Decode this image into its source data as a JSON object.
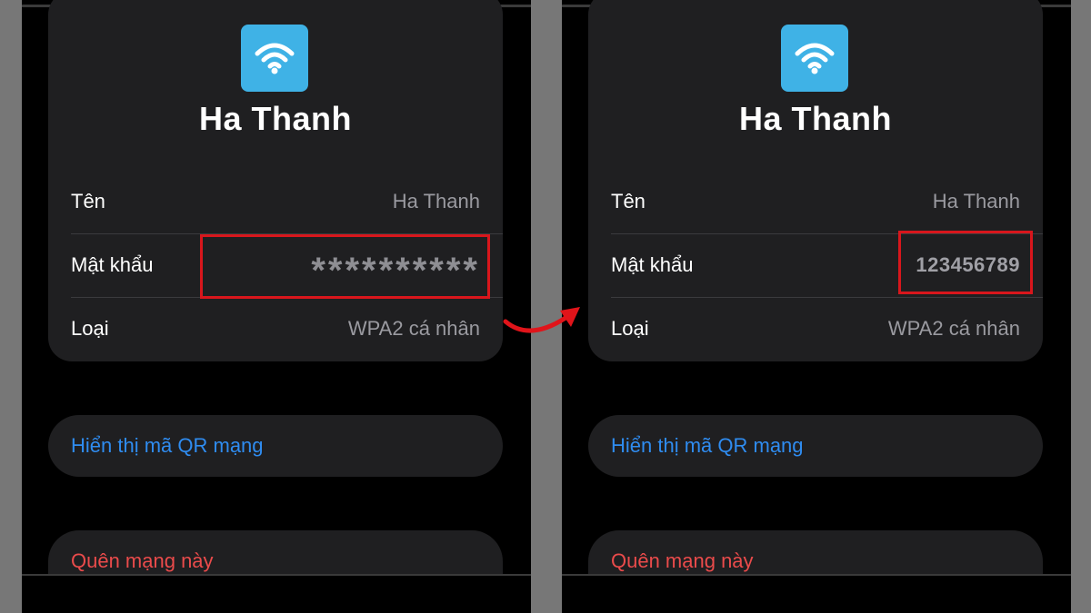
{
  "panels": [
    {
      "network_name": "Ha Thanh",
      "rows": [
        {
          "label": "Tên",
          "value": "Ha Thanh"
        },
        {
          "label": "Mật khẩu",
          "value": "**********"
        },
        {
          "label": "Loại",
          "value": "WPA2 cá nhân"
        }
      ],
      "show_qr_label": "Hiển thị mã QR mạng",
      "forget_label": "Quên mạng này"
    },
    {
      "network_name": "Ha Thanh",
      "rows": [
        {
          "label": "Tên",
          "value": "Ha Thanh"
        },
        {
          "label": "Mật khẩu",
          "value": "123456789"
        },
        {
          "label": "Loại",
          "value": "WPA2 cá nhân"
        }
      ],
      "show_qr_label": "Hiển thị mã QR mạng",
      "forget_label": "Quên mạng này"
    }
  ],
  "colors": {
    "wifi_icon_bg": "#3fb2e6",
    "link_blue": "#2f8cf0",
    "destructive_red": "#ea4b4b",
    "highlight_red": "#d8161c"
  },
  "icons": {
    "app_icon": "wifi-icon",
    "annotation": "curved-arrow-icon"
  }
}
